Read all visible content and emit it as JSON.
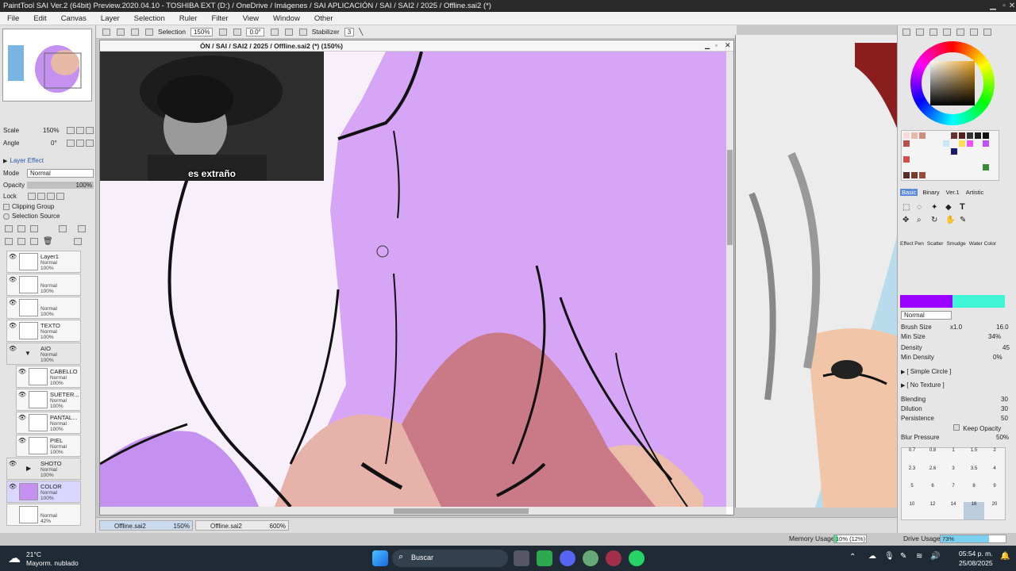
{
  "window": {
    "title": "PaintTool SAI Ver.2 (64bit) Preview.2020.04.10 - TOSHIBA EXT (D:) / OneDrive / Imágenes / SAI APLICACIÓN / SAI / SAI2 / 2025 / Offline.sai2 (*)"
  },
  "menu": [
    "File",
    "Edit",
    "Canvas",
    "Layer",
    "Selection",
    "Ruler",
    "Filter",
    "View",
    "Window",
    "Other"
  ],
  "navigator": {
    "scale_label": "Scale",
    "scale_value": "150%",
    "angle_label": "Angle",
    "angle_value": "0°"
  },
  "layer_props": {
    "layer_effect": "Layer Effect",
    "mode_label": "Mode",
    "mode_value": "Normal",
    "opacity_label": "Opacity",
    "opacity_value": "100%",
    "lock_label": "Lock",
    "clipping_group": "Clipping Group",
    "selection_source": "Selection Source"
  },
  "layers": [
    {
      "name": "Layer1",
      "mode": "Normal",
      "opacity": "100%",
      "indent": false
    },
    {
      "name": "",
      "mode": "Normal",
      "opacity": "100%",
      "indent": false
    },
    {
      "name": "",
      "mode": "Normal",
      "opacity": "100%",
      "indent": false
    },
    {
      "name": "TEXTO",
      "mode": "Normal",
      "opacity": "100%",
      "indent": false
    },
    {
      "name": "AIO",
      "mode": "Normal",
      "opacity": "100%",
      "indent": false
    },
    {
      "name": "CABELLO",
      "mode": "Normal",
      "opacity": "100%",
      "indent": true
    },
    {
      "name": "SUETER...",
      "mode": "Normal",
      "opacity": "100%",
      "indent": true
    },
    {
      "name": "PANTAL...",
      "mode": "Normal",
      "opacity": "100%",
      "indent": true
    },
    {
      "name": "PIEL",
      "mode": "Normal",
      "opacity": "100%",
      "indent": true
    },
    {
      "name": "SHOTO",
      "mode": "Normal",
      "opacity": "100%",
      "indent": false
    },
    {
      "name": "COLOR",
      "mode": "Normal",
      "opacity": "100%",
      "indent": false
    },
    {
      "name": "",
      "mode": "Normal",
      "opacity": "42%",
      "indent": false
    }
  ],
  "toolbar": {
    "selection_label": "Selection",
    "zoom_value": "150%",
    "rotate_value": "0.0°",
    "stabilizer_label": "Stabilizer",
    "stabilizer_value": "3"
  },
  "document": {
    "title": "ÓN / SAI / SAI2 / 2025 / Offline.sai2 (*) (150%)",
    "subtitle": "es extraño"
  },
  "right_panel": {
    "tool_tabs": [
      "Basic",
      "Binary",
      "Ver.1",
      "Artistic"
    ],
    "effect_labels": [
      "Effect Pen",
      "Scatter",
      "Smudge",
      "Water Color"
    ],
    "blend_mode": "Normal",
    "brush_size_label": "Brush Size",
    "brush_size_mult": "x1.0",
    "brush_size_value": "16.0",
    "min_size_label": "Min Size",
    "min_size_value": "34%",
    "density_label": "Density",
    "density_value": "45",
    "min_density_label": "Min Density",
    "min_density_value": "0%",
    "shape_label": "[ Simple Circle ]",
    "texture_label": "[ No Texture ]",
    "blending_label": "Blending",
    "blending_value": "30",
    "dilution_label": "Dilution",
    "dilution_value": "30",
    "persistence_label": "Persistence",
    "persistence_value": "50",
    "keep_opacity_label": "Keep Opacity",
    "blur_pressure_label": "Blur Pressure",
    "blur_pressure_value": "50%",
    "brush_sizes": [
      "0.7",
      "0.8",
      "1",
      "1.5",
      "2",
      "2.3",
      "2.6",
      "3",
      "3.5",
      "4",
      "5",
      "6",
      "7",
      "8",
      "9",
      "10",
      "12",
      "14",
      "16",
      "20"
    ]
  },
  "doc_tabs": [
    {
      "name": "Offline.sai2",
      "zoom": "150%"
    },
    {
      "name": "Offline.sai2",
      "zoom": "600%"
    }
  ],
  "status": {
    "memory_label": "Memory Usage",
    "memory_value": "10% (12%)",
    "drive_label": "Drive Usage",
    "drive_value": "73%"
  },
  "taskbar": {
    "weather_temp": "21°C",
    "weather_desc": "Mayorm. nublado",
    "search_label": "Buscar",
    "time": "05:54 p. m.",
    "date": "25/08/2025"
  },
  "colors": {
    "primary": "#9b00ff",
    "secondary": "#3ff5d6",
    "canvas_purple": "#d7a5f6",
    "accent_blue": "#5a8ad6"
  }
}
